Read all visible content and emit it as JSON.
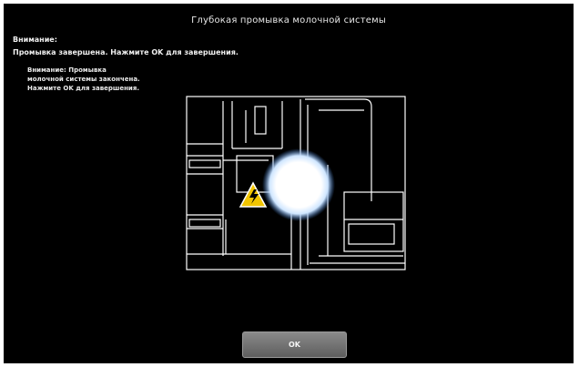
{
  "dialog": {
    "title": "Глубокая промывка молочной системы",
    "warning_label": "Внимание:",
    "warning_text": "Промывка завершена. Нажмите OK для завершения."
  },
  "callout": {
    "lines": [
      "Внимание: Промывка",
      "молочной системы закончена.",
      "Нажмите OK для завершения."
    ]
  },
  "illustration": {
    "icon": "hazard-warning-icon",
    "indicator": "touch-indicator",
    "line_color": "#ffffff",
    "hazard_color": "#f2c500"
  },
  "buttons": {
    "ok_label": "OK"
  }
}
